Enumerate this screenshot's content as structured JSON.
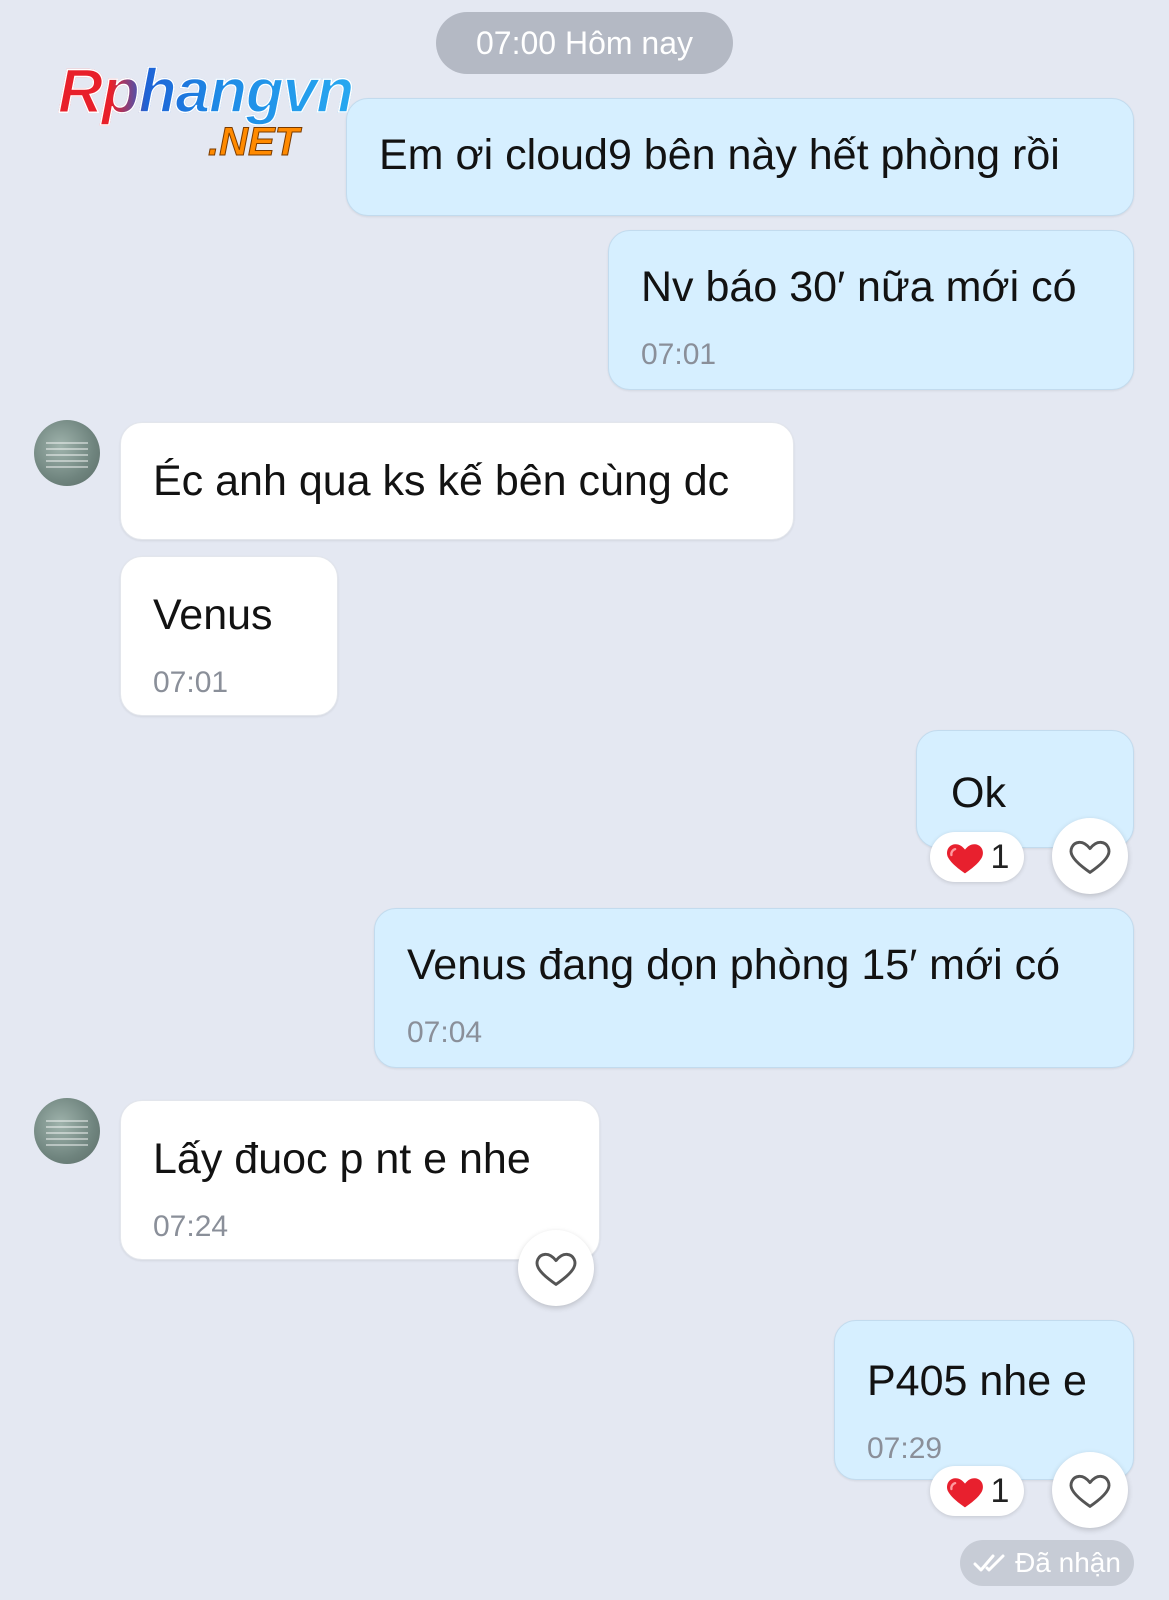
{
  "date_separator": "07:00 Hôm nay",
  "watermark": {
    "main": "Rphangvn",
    "sub": ".NET"
  },
  "messages": [
    {
      "direction": "sent",
      "text": "Em ơi cloud9 bên này hết phòng rồi",
      "time": ""
    },
    {
      "direction": "sent",
      "text": "Nv báo 30′ nữa mới có",
      "time": "07:01"
    },
    {
      "direction": "received",
      "text": "Éc anh qua ks kế bên cùng dc",
      "time": ""
    },
    {
      "direction": "received",
      "text": "Venus",
      "time": "07:01"
    },
    {
      "direction": "sent",
      "text": "Ok",
      "time": "",
      "reaction": {
        "emoji": "heart",
        "count": "1"
      }
    },
    {
      "direction": "sent",
      "text": "Venus đang dọn phòng 15′ mới có",
      "time": "07:04"
    },
    {
      "direction": "received",
      "text": "Lấy đuoc p nt  e nhe",
      "time": "07:24"
    },
    {
      "direction": "sent",
      "text": "P405 nhe e",
      "time": "07:29",
      "reaction": {
        "emoji": "heart",
        "count": "1"
      }
    }
  ],
  "status": "Đã nhận",
  "colors": {
    "background": "#e4e8f2",
    "sent_bubble": "#d6efff",
    "received_bubble": "#ffffff",
    "heart": "#e8202e"
  },
  "icons": [
    "heart-outline-icon",
    "heart-filled-icon",
    "double-check-icon",
    "avatar"
  ]
}
